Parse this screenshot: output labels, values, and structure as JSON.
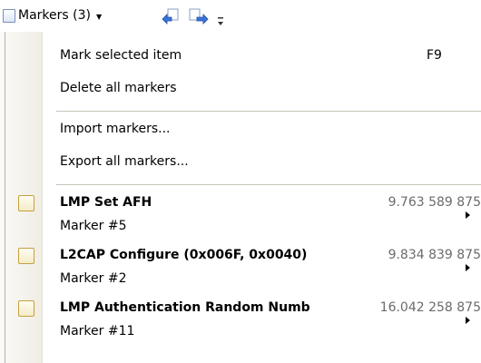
{
  "toolbar": {
    "markers_label": "Markers (3)",
    "icons": {
      "doc": "document-icon",
      "prev": "previous-marker-icon",
      "next": "next-marker-icon",
      "overflow": "toolbar-overflow-icon"
    }
  },
  "menu": {
    "mark_selected": {
      "label": "Mark selected item",
      "shortcut": "F9"
    },
    "delete_all": {
      "label": "Delete all markers"
    },
    "import": {
      "label": "Import markers..."
    },
    "export": {
      "label": "Export all markers..."
    },
    "markers": [
      {
        "title": "LMP Set AFH",
        "time": "9.763 589 875",
        "subtitle": "Marker #5"
      },
      {
        "title": "L2CAP Configure (0x006F, 0x0040)",
        "time": "9.834 839 875",
        "subtitle": "Marker #2"
      },
      {
        "title": "LMP Authentication Random Numb",
        "time": "16.042 258 875",
        "subtitle": "Marker #11"
      }
    ]
  },
  "colors": {
    "gutter": "#f0ede4",
    "checkbox_border": "#c4a03f",
    "arrow_blue": "#3a74d8"
  }
}
